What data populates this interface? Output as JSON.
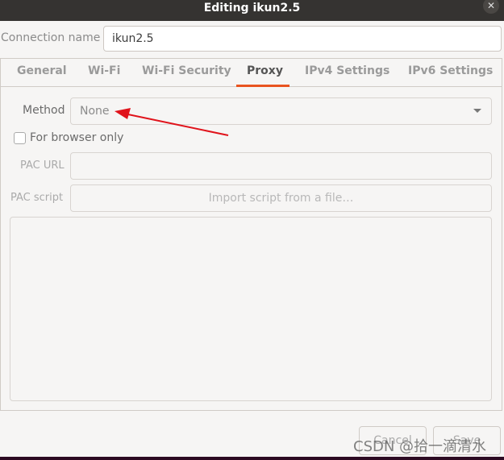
{
  "window": {
    "title": "Editing ikun2.5",
    "close_icon": "close-icon"
  },
  "connection": {
    "label": "Connection name",
    "value": "ikun2.5"
  },
  "tabs": [
    {
      "label": "General"
    },
    {
      "label": "Wi-Fi"
    },
    {
      "label": "Wi-Fi Security"
    },
    {
      "label": "Proxy",
      "active": true
    },
    {
      "label": "IPv4 Settings"
    },
    {
      "label": "IPv6 Settings"
    }
  ],
  "accent": "#e95420",
  "proxy": {
    "method_label": "Method",
    "method_value": "None",
    "browser_only_label": "For browser only",
    "pac_url_label": "PAC URL",
    "pac_script_label": "PAC script",
    "import_label": "Import script from a file…"
  },
  "buttons": {
    "cancel": "Cancel",
    "save": "Save"
  },
  "watermark": "CSDN @拾一滴清水"
}
